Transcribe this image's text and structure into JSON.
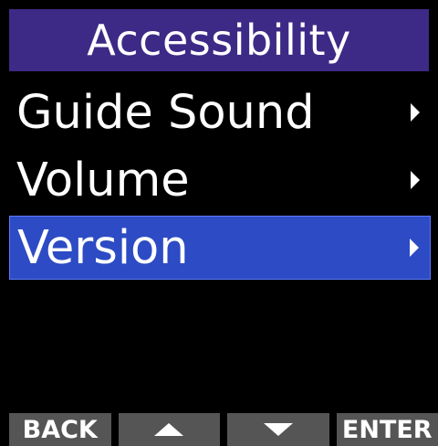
{
  "title": "Accessibility",
  "menu": {
    "items": [
      {
        "label": "Guide Sound",
        "selected": false
      },
      {
        "label": "Volume",
        "selected": false
      },
      {
        "label": "Version",
        "selected": true
      }
    ]
  },
  "softkeys": {
    "back_label": "BACK",
    "up_icon": "triangle-up-icon",
    "down_icon": "triangle-down-icon",
    "enter_label": "ENTER"
  },
  "colors": {
    "title_bg": "#3d2a86",
    "selected_bg": "#2c4bc4",
    "softkey_bg": "#555555",
    "background": "#000000",
    "text": "#ffffff"
  }
}
